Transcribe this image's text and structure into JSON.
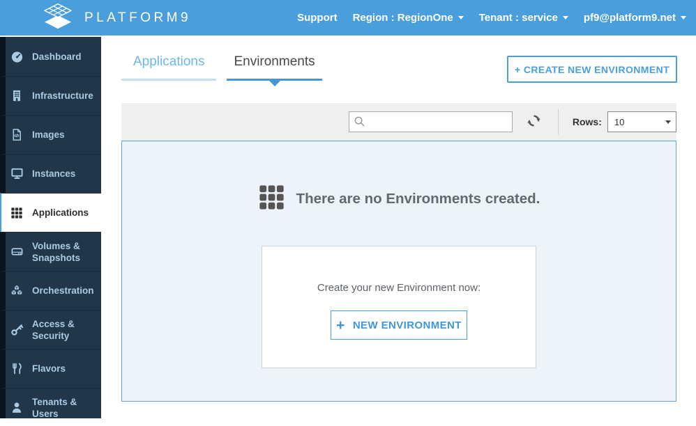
{
  "topbar": {
    "logo_text": "PLATFORM9",
    "support_label": "Support",
    "region_label": "Region : RegionOne",
    "tenant_label": "Tenant : service",
    "user_label": "pf9@platform9.net"
  },
  "sidebar": {
    "items": [
      {
        "label": "Dashboard",
        "icon": "gauge-icon",
        "active": false
      },
      {
        "label": "Infrastructure",
        "icon": "building-icon",
        "active": false
      },
      {
        "label": "Images",
        "icon": "file-code-icon",
        "active": false
      },
      {
        "label": "Instances",
        "icon": "monitor-icon",
        "active": false
      },
      {
        "label": "Applications",
        "icon": "grid-icon",
        "active": true
      },
      {
        "label": "Volumes & Snapshots",
        "icon": "drive-icon",
        "active": false
      },
      {
        "label": "Orchestration",
        "icon": "cubes-icon",
        "active": false
      },
      {
        "label": "Access & Security",
        "icon": "key-icon",
        "active": false
      },
      {
        "label": "Flavors",
        "icon": "cutlery-icon",
        "active": false
      },
      {
        "label": "Tenants & Users",
        "icon": "user-icon",
        "active": false
      }
    ]
  },
  "tabs": {
    "applications": "Applications",
    "environments": "Environments",
    "active_tab": "Environments"
  },
  "actions": {
    "create_new_environment": "+ CREATE NEW ENVIRONMENT"
  },
  "toolbar": {
    "search_placeholder": "",
    "search_value": "",
    "rows_label": "Rows:",
    "rows_value": "10"
  },
  "empty_state": {
    "title": "There are no Environments created.",
    "card_text": "Create your new Environment now:",
    "new_environment_plus": "+",
    "new_environment_label": "NEW ENVIRONMENT"
  },
  "colors": {
    "topbar_blue": "#4a9edb",
    "sidebar_navy": "#223649",
    "sidebar_edge": "#0a141e",
    "sidebar_text": "#a9cbe5",
    "accent_blue": "#4a9edb",
    "tab_active_underline": "#4a96d2",
    "tab_inactive_text": "#6cb8ec",
    "tab_inactive_underline": "#c5e1f6",
    "toolbar_gray": "#efefef",
    "panel_bg": "#edf3fb",
    "panel_border": "#5ba2d7",
    "muted_text": "#62686e"
  }
}
